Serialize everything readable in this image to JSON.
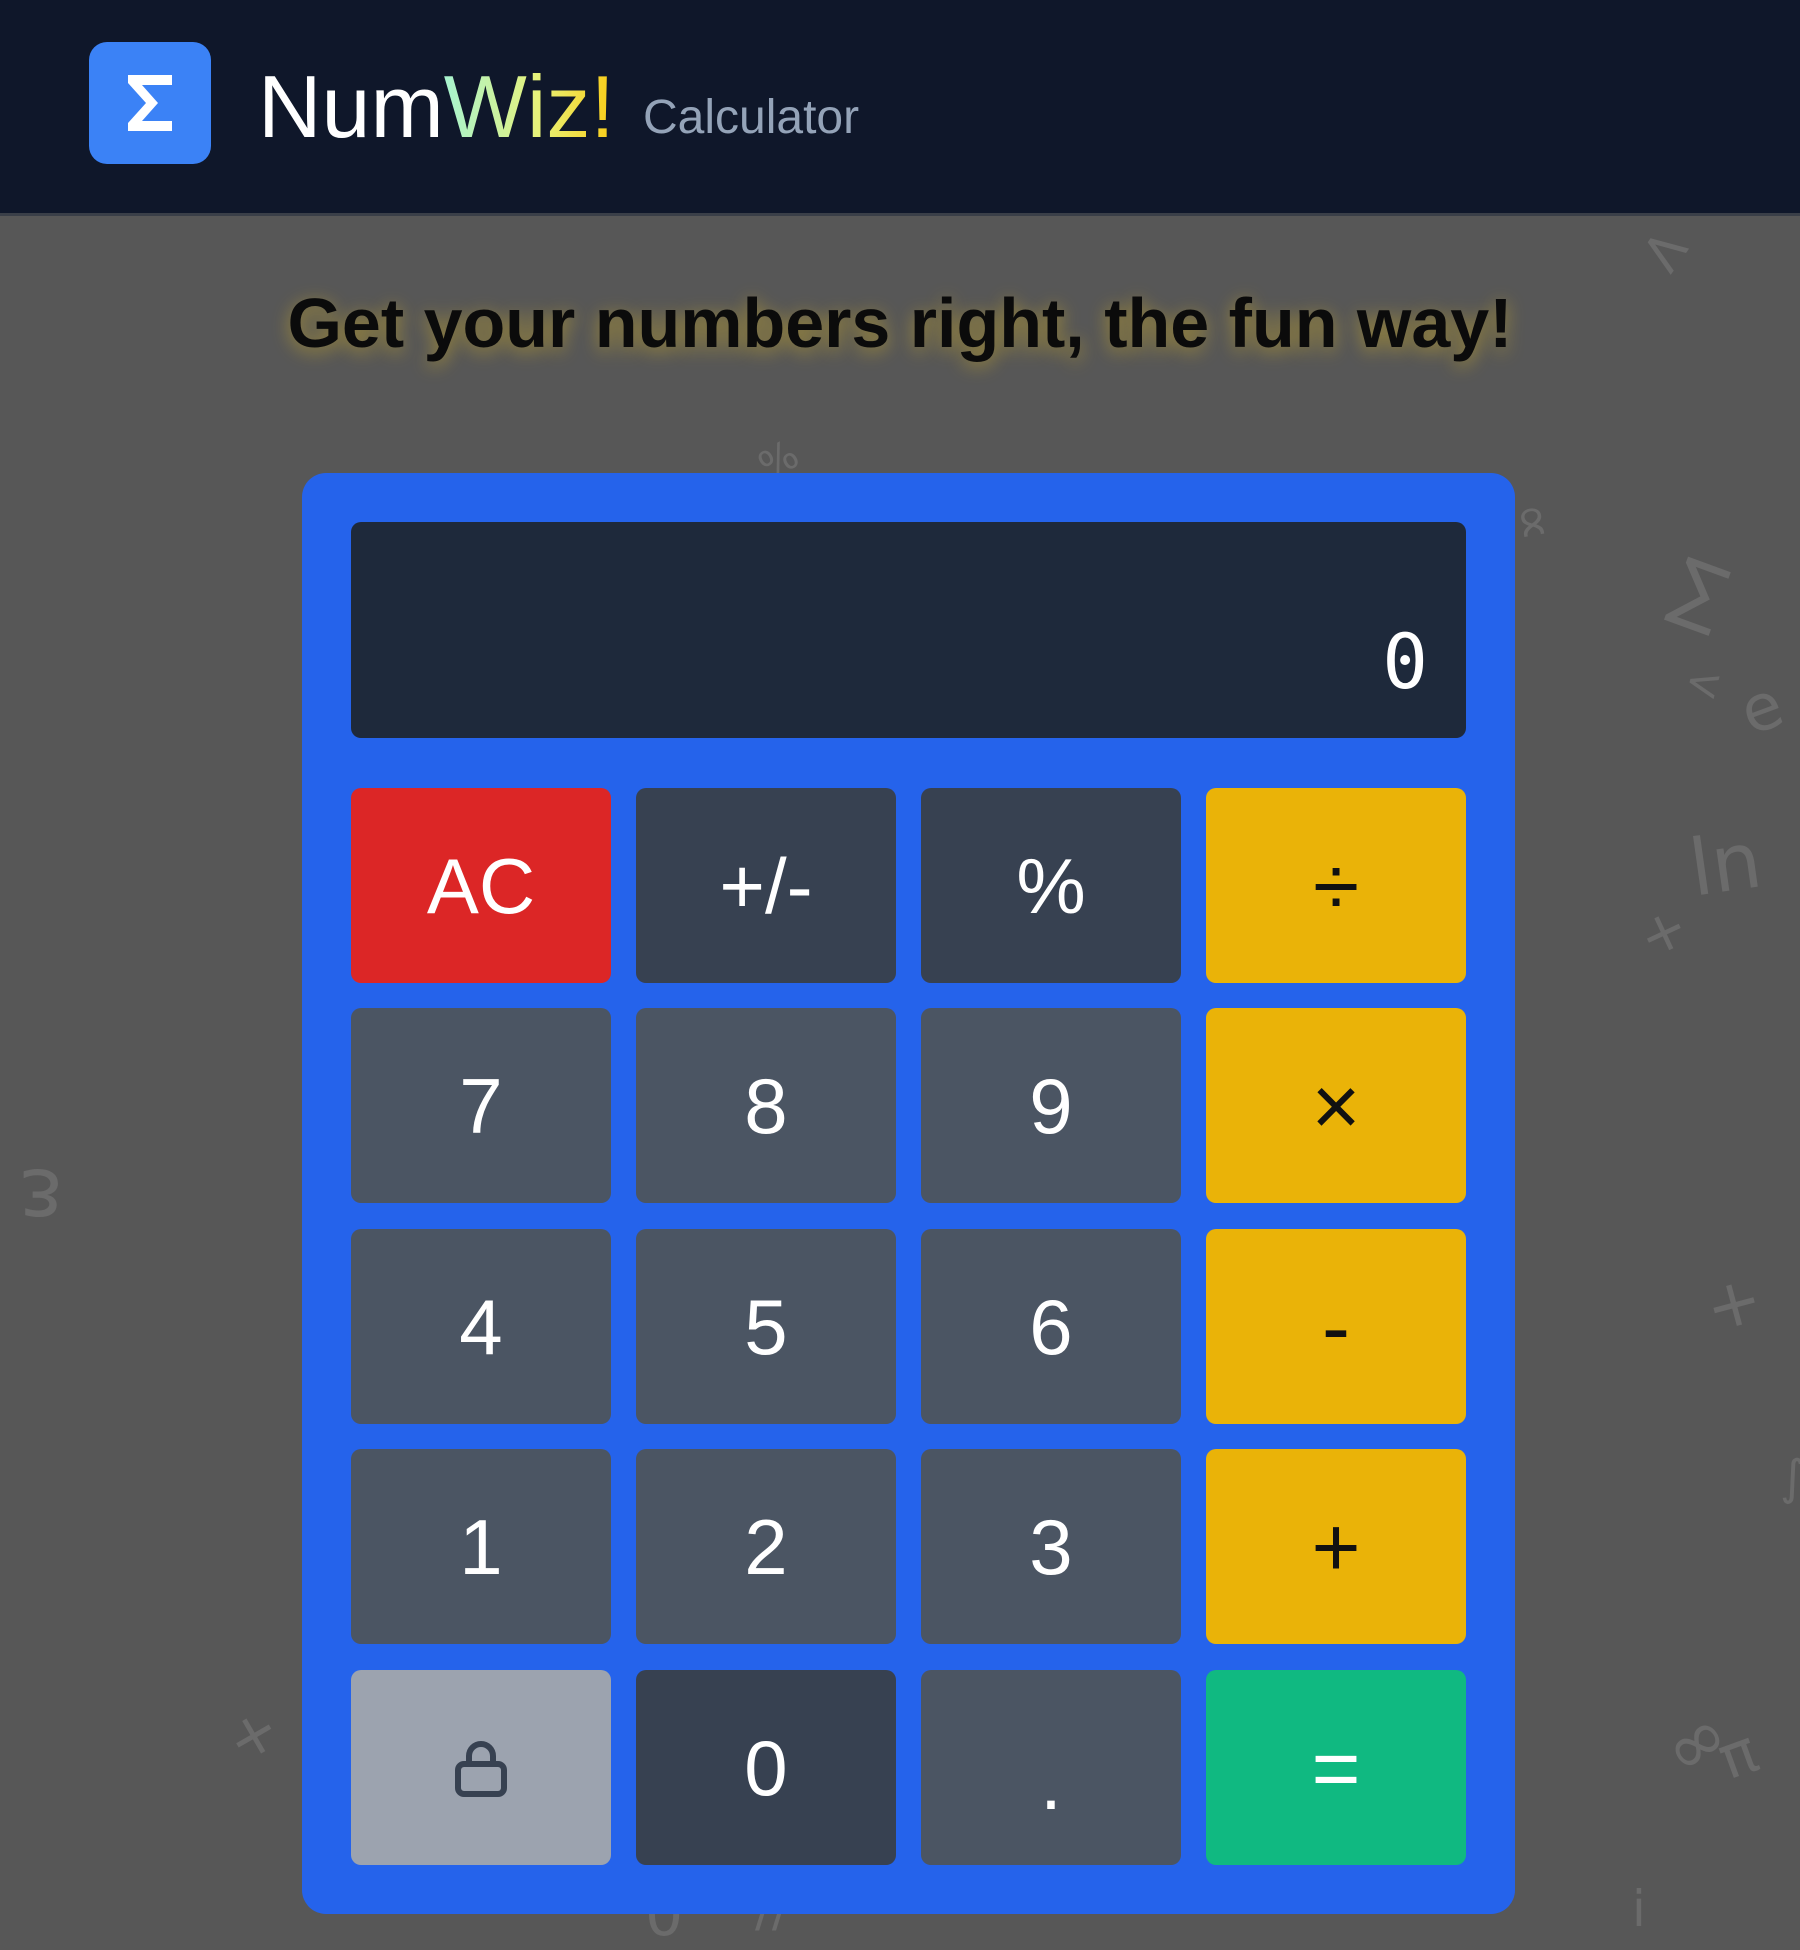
{
  "header": {
    "brand_part1": "Num",
    "brand_part2": "Wiz!",
    "subtitle": "Calculator",
    "logo_icon": "sigma-icon",
    "logo_symbol": "Σ"
  },
  "tagline": "Get your numbers right, the fun way!",
  "display": {
    "value": "0"
  },
  "keys": {
    "clear": "AC",
    "sign": "+/-",
    "percent": "%",
    "divide": "÷",
    "seven": "7",
    "eight": "8",
    "nine": "9",
    "multiply": "×",
    "four": "4",
    "five": "5",
    "six": "6",
    "subtract": "-",
    "one": "1",
    "two": "2",
    "three": "3",
    "add": "+",
    "lock_icon": "lock-icon",
    "zero": "0",
    "decimal": ".",
    "equals": "="
  },
  "colors": {
    "header_bg": "#0f172a",
    "page_bg": "#575757",
    "calculator_body": "#2563eb",
    "display_bg": "#1e293b",
    "clear_key": "#dc2626",
    "function_key": "#374151",
    "number_key": "#4b5563",
    "operator_key": "#eab308",
    "equals_key": "#10b981",
    "lock_key": "#9ca3af",
    "logo_tile": "#3b82f6"
  }
}
